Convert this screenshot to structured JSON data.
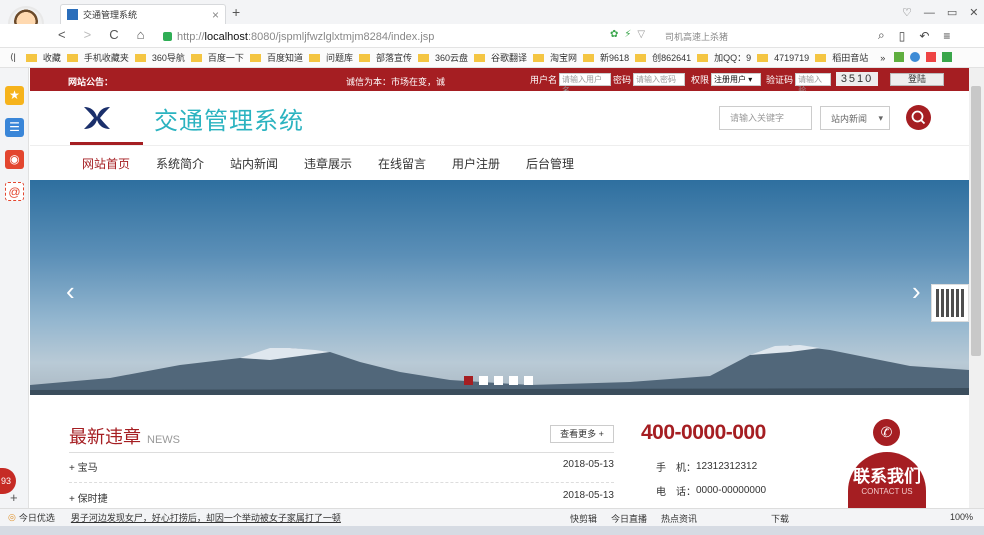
{
  "browser": {
    "tab_title": "交通管理系统",
    "url_prefix": "http://",
    "url_host": "localhost",
    "url_rest": ":8080/jspmljfwzlglxtmjm8284/index.jsp",
    "search_hint": "司机高速上杀猪",
    "back_label": "<",
    "forward_label": ">",
    "reload_label": "C",
    "home_label": "⌂",
    "new_tab_label": "+",
    "close_tab_label": "×"
  },
  "bookmarks": [
    "收藏",
    "手机收藏夹",
    "360导航",
    "百度一下",
    "百度知道",
    "问题库",
    "部落宣传",
    "360云盘",
    "谷歌翻译",
    "淘宝网",
    "新9618",
    "创862641",
    "加QQ：9",
    "4719719",
    "稻田音站"
  ],
  "bookmarks_more": "»",
  "site": {
    "notice_label": "网站公告：",
    "notice_text": "诚信为本：市场在变，诚",
    "username_label": "用户名",
    "username_placeholder": "请输入用户名",
    "password_label": "密码",
    "password_placeholder": "请输入密码",
    "role_label": "权限",
    "role_value": "注册用户",
    "captcha_label": "验证码",
    "captcha_placeholder": "请输入验",
    "captcha_value": "3510",
    "login_label": "登陆",
    "logo_title": "交通管理系统",
    "search_placeholder": "请输入关键字",
    "search_scope": "站内新闻",
    "nav": [
      "网站首页",
      "系统简介",
      "站内新闻",
      "违章展示",
      "在线留言",
      "用户注册",
      "后台管理"
    ]
  },
  "news": {
    "title": "最新违章",
    "title_en": "NEWS",
    "more_label": "查看更多 +",
    "items": [
      {
        "name": "+ 宝马",
        "date": "2018-05-13"
      },
      {
        "name": "+ 保时捷",
        "date": "2018-05-13"
      }
    ]
  },
  "contact": {
    "hotline": "400-0000-000",
    "mobile_label": "手　机：",
    "mobile": "12312312312",
    "phone_label": "电　话：",
    "phone": "0000-00000000",
    "contact_us": "联系我们",
    "contact_us_en": "CONTACT US"
  },
  "statusbar": {
    "left_label": "今日优选",
    "headline": "男子河边发现女尸，好心打捞后，却因一个举动被女子家属打了一顿",
    "items": [
      "快剪辑",
      "今日直播",
      "热点资讯",
      "下载"
    ],
    "zoom": "100%"
  },
  "badge_count": "93",
  "colors": {
    "brand_red": "#a51e22",
    "logo_teal": "#2bb3c0"
  }
}
